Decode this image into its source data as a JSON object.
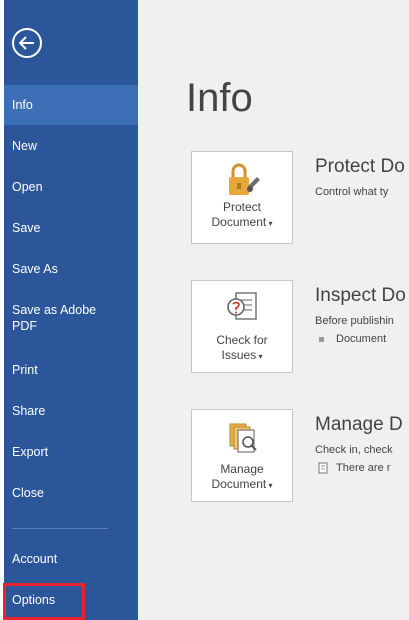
{
  "sidebar": {
    "items": [
      {
        "label": "Info",
        "active": true
      },
      {
        "label": "New"
      },
      {
        "label": "Open"
      },
      {
        "label": "Save"
      },
      {
        "label": "Save As"
      },
      {
        "label": "Save as Adobe PDF"
      },
      {
        "label": "Print"
      },
      {
        "label": "Share"
      },
      {
        "label": "Export"
      },
      {
        "label": "Close"
      },
      {
        "label": "Account"
      },
      {
        "label": "Options",
        "highlighted": true
      }
    ],
    "bg_color": "#2b579a",
    "active_color": "#3c6fb5"
  },
  "main": {
    "title": "Info",
    "sections": [
      {
        "button_label_line1": "Protect",
        "button_label_line2": "Document",
        "title": "Protect Do",
        "description": "Control what ty",
        "icon": "lock-icon"
      },
      {
        "button_label_line1": "Check for",
        "button_label_line2": "Issues",
        "title": "Inspect Do",
        "description": "Before publishin",
        "bullet": "Document",
        "icon": "inspect-icon"
      },
      {
        "button_label_line1": "Manage",
        "button_label_line2": "Document",
        "title": "Manage D",
        "description": "Check in, check",
        "bullet": "There are r",
        "icon": "manage-document-icon"
      }
    ]
  },
  "highlight_color": "#e8232e"
}
